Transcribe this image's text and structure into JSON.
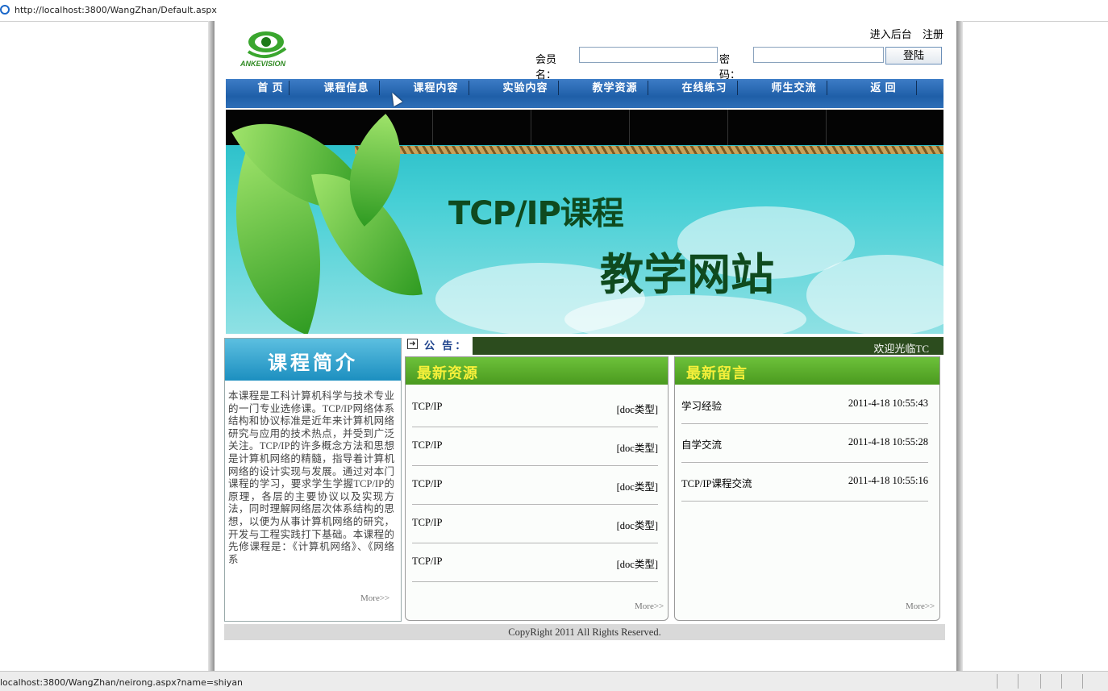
{
  "browser": {
    "url": "http://localhost:3800/WangZhan/Default.aspx"
  },
  "header": {
    "logo_text": "ANKEVISION",
    "admin_link": "进入后台",
    "register_link": "注册",
    "username_label": "会员名：",
    "password_label": "密码：",
    "username_value": "",
    "password_value": "",
    "login_button": "登陆"
  },
  "nav": [
    {
      "label": "首 页"
    },
    {
      "label": "课程信息"
    },
    {
      "label": "课程内容"
    },
    {
      "label": "实验内容"
    },
    {
      "label": "教学资源"
    },
    {
      "label": "在线练习"
    },
    {
      "label": "师生交流"
    },
    {
      "label": "返 回"
    }
  ],
  "banner": {
    "title_line1": "TCP/IP课程",
    "title_line2": "教学网站"
  },
  "intro": {
    "heading": "课程简介",
    "text": "本课程是工科计算机科学与技术专业的一门专业选修课。TCP/IP网络体系结构和协议标准是近年来计算机网络研究与应用的技术热点，并受到广泛关注。TCP/IP的许多概念方法和思想是计算机网络的精髓，指导着计算机网络的设计实现与发展。通过对本门课程的学习，要求学生学握TCP/IP的原理，各层的主要协议以及实现方法，同时理解网络层次体系结构的思想，以便为从事计算机网络的研究，开发与工程实践打下基础。本课程的先修课程是：《计算机网络》、《网络系",
    "more": "More>>"
  },
  "notice": {
    "label": "公 告：",
    "marquee": "欢迎光临TC"
  },
  "resources": {
    "heading": "最新资源",
    "items": [
      {
        "name": "TCP/IP",
        "type": "[doc类型]"
      },
      {
        "name": "TCP/IP",
        "type": "[doc类型]"
      },
      {
        "name": "TCP/IP",
        "type": "[doc类型]"
      },
      {
        "name": "TCP/IP",
        "type": "[doc类型]"
      },
      {
        "name": "TCP/IP",
        "type": "[doc类型]"
      }
    ],
    "more": "More>>"
  },
  "messages": {
    "heading": "最新留言",
    "items": [
      {
        "title": "学习经验",
        "time": "2011-4-18 10:55:43"
      },
      {
        "title": "自学交流",
        "time": "2011-4-18 10:55:28"
      },
      {
        "title": "TCP/IP课程交流",
        "time": "2011-4-18 10:55:16"
      }
    ],
    "more": "More>>"
  },
  "footer": {
    "copyright": "CopyRight 2011 All Rights Reserved."
  },
  "status": {
    "text": "localhost:3800/WangZhan/neirong.aspx?name=shiyan"
  },
  "colors": {
    "nav": "#1f5fa8",
    "panel_header": "#5aa92a",
    "panel_title": "#f6f03a",
    "notice_bar": "#2c4c1e"
  }
}
